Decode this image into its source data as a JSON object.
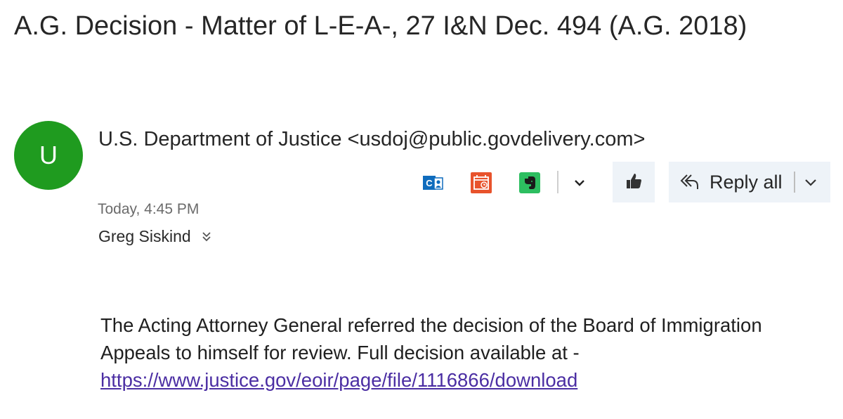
{
  "email": {
    "subject": "A.G. Decision - Matter of L-E-A-, 27 I&N Dec. 494 (A.G. 2018)",
    "avatar_initial": "U",
    "sender": "U.S. Department of Justice <usdoj@public.govdelivery.com>",
    "timestamp": "Today, 4:45 PM",
    "recipient": "Greg Siskind",
    "body_text": "The Acting Attorney General referred the decision of the Board of Immigration Appeals to himself for review. Full decision available at -",
    "link": "https://www.justice.gov/eoir/page/file/1116866/download"
  },
  "toolbar": {
    "icons": [
      "outlook-contact-icon",
      "calendar-icon",
      "evernote-icon",
      "chevron-down-icon",
      "like-icon"
    ],
    "reply_label": "Reply all"
  },
  "colors": {
    "avatar": "#1f9b1f",
    "link": "#4b2ea3",
    "button_bg": "#eef3f8"
  }
}
